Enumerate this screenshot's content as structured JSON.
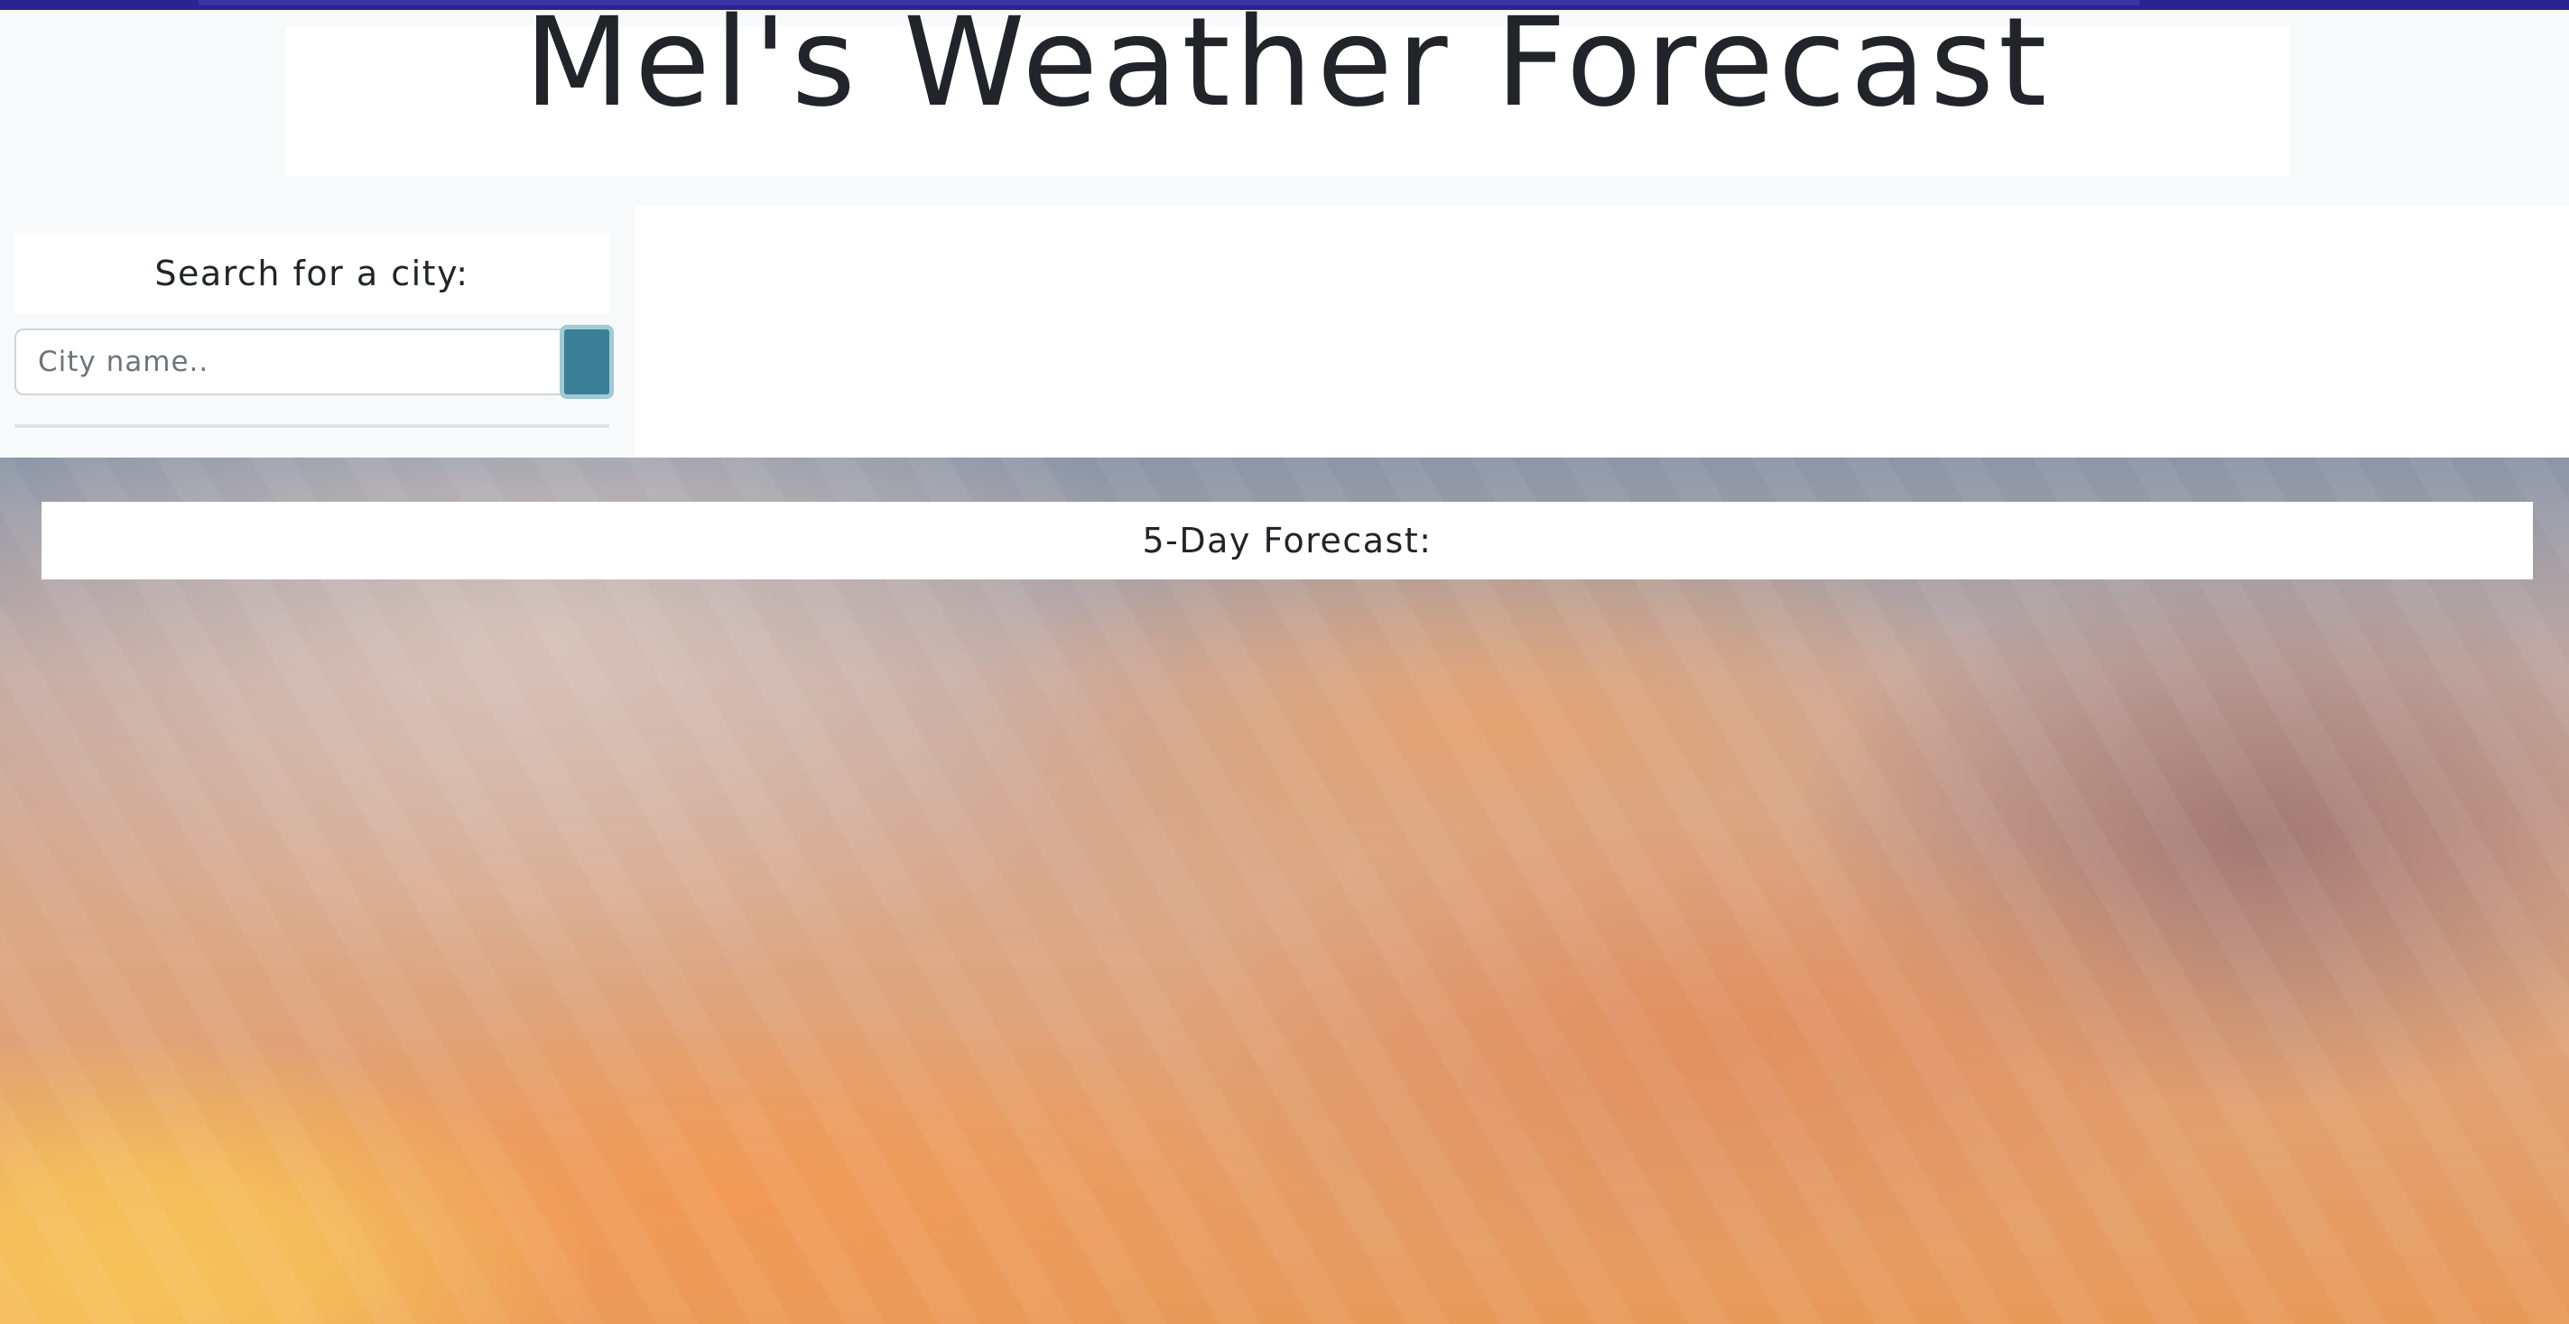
{
  "header": {
    "title": "Mel's Weather Forecast"
  },
  "sidebar": {
    "search_label": "Search for a city:",
    "search_placeholder": "City name..",
    "search_value": ""
  },
  "forecast": {
    "heading": "5-Day Forecast:"
  },
  "colors": {
    "top_bar": "#2a2390",
    "search_button": "#3a7f96",
    "panel_background": "#ffffff",
    "page_background": "#f8f9fa"
  }
}
